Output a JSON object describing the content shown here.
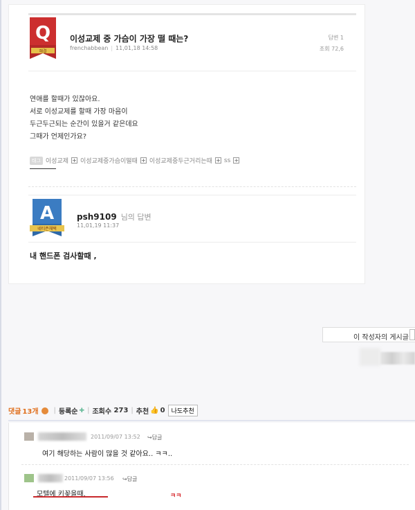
{
  "question": {
    "badge_letter": "Q",
    "badge_label": "해결",
    "title": "이성교제 중 가슴이 가장 떨 때는?",
    "author": "frenchabbean",
    "date": "11,01,18 14:58",
    "answers": "답변 1",
    "views": "조회 72,6",
    "body": [
      "연애를 할때가 있잖아요.",
      "서로 이성교제를 할때 가장 마음이",
      "두근두근되는 순간이 있을거 같은데요",
      "그때가 언제인가요?"
    ],
    "tags": [
      "이성교제",
      "이성교제중가슴이떨때",
      "이성교제중두근거리는때",
      "ss"
    ],
    "tag_chip": "태그"
  },
  "answer": {
    "badge_letter": "A",
    "badge_label": "네티즌채택",
    "username": "psh9109",
    "suffix": "님의 답변",
    "date": "11,01,19 11:37",
    "body": "내 핸드폰 검사할때 ,"
  },
  "author_posts": {
    "label": "이 작성자의 게시글"
  },
  "comment_bar": {
    "label": "댓글",
    "count": "13개",
    "sort": "등록순",
    "views_label": "조회수",
    "views": "273",
    "recommend_label": "추천",
    "recommend_count": "0",
    "recommend_button": "나도추천"
  },
  "comments": [
    {
      "time": "2011/09/07 13:52",
      "reply": "↪답글",
      "text": "여기 해당하는 사람이 많을 것 같아요.. ㅋㅋ.."
    },
    {
      "time": "2011/09/07 13:56",
      "reply": "↪답글",
      "text": "모텔에 키꽂을때."
    }
  ],
  "annotation": "ㅋㅋ",
  "colors": {
    "q_badge": "#cc2f2f",
    "a_badge": "#3b7cc2",
    "accent_orange": "#e0701e",
    "underline_red": "#c8292c"
  }
}
